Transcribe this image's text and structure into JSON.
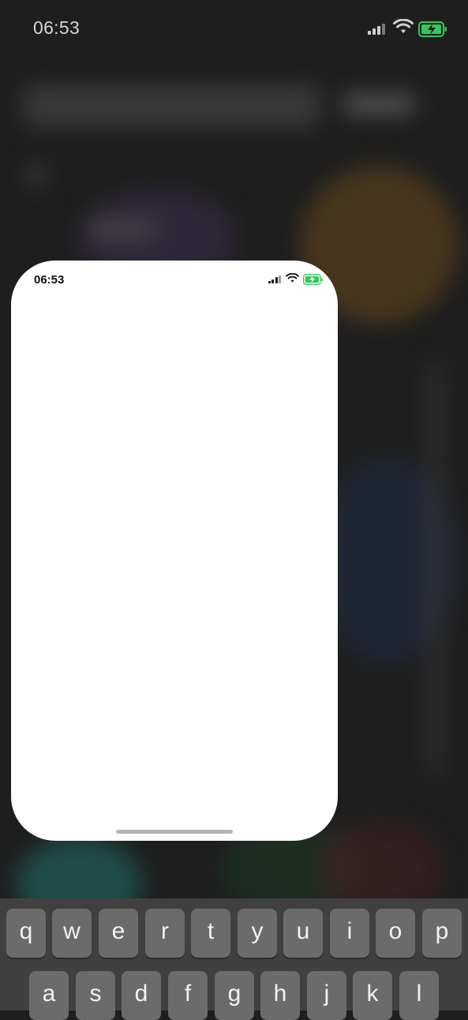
{
  "status_bar": {
    "time": "06:53",
    "icons": [
      "cellular-signal-icon",
      "wifi-icon",
      "battery-charging-icon"
    ]
  },
  "card": {
    "status_time": "06:53",
    "icons": [
      "cellular-signal-icon",
      "wifi-icon",
      "battery-charging-icon"
    ]
  },
  "keyboard": {
    "row1": [
      "q",
      "w",
      "e",
      "r",
      "t",
      "y",
      "u",
      "i",
      "o",
      "p"
    ],
    "row2": [
      "a",
      "s",
      "d",
      "f",
      "g",
      "h",
      "j",
      "k",
      "l"
    ]
  },
  "colors": {
    "battery_green": "#35c759",
    "key_fill": "#6b6b6b",
    "keyboard_bg": "#404040"
  }
}
